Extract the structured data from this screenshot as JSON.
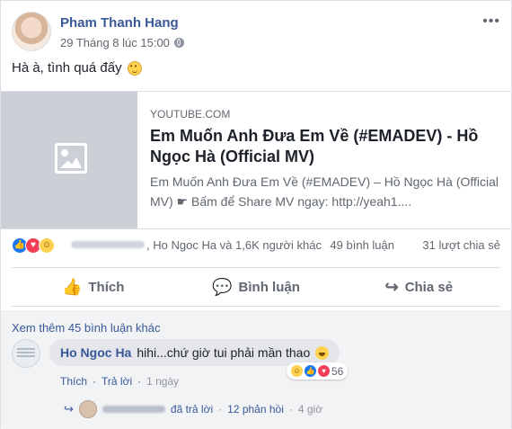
{
  "post": {
    "author": "Pham Thanh Hang",
    "timestamp": "29 Tháng 8 lúc 15:00",
    "privacy_icon": "globe-icon",
    "menu_icon": "more-icon",
    "status": "Hà à, tình quá đấy",
    "emoji": "smile-icon"
  },
  "link_card": {
    "domain": "YOUTUBE.COM",
    "title": "Em Muốn Anh Đưa Em Về (#EMADEV) - Hồ Ngọc Hà (Official MV)",
    "description": "Em Muốn Anh Đưa Em Về (#EMADEV) – Hồ Ngọc Hà (Official MV) ☛ Bấm để Share MV ngay: http://yeah1...."
  },
  "stats": {
    "separator": ",",
    "likers": "Ho Ngoc Ha và 1,6K người khác",
    "comments": "49 bình luận",
    "shares": "31 lượt chia sẻ"
  },
  "actions": {
    "like": "Thích",
    "comment": "Bình luận",
    "share": "Chia sẻ"
  },
  "comments": {
    "view_more": "Xem thêm 45 bình luận khác",
    "commenter": "Ho Ngoc Ha",
    "text": "hihi...chứ giờ tui phải mần thao",
    "reaction_count": "56",
    "like_action": "Thích",
    "reply_action": "Trả lời",
    "dot": "·",
    "time": "1 ngày",
    "reply_summary": "đã trả lời",
    "reply_count": "12 phản hồi",
    "reply_time": "4 giờ"
  }
}
